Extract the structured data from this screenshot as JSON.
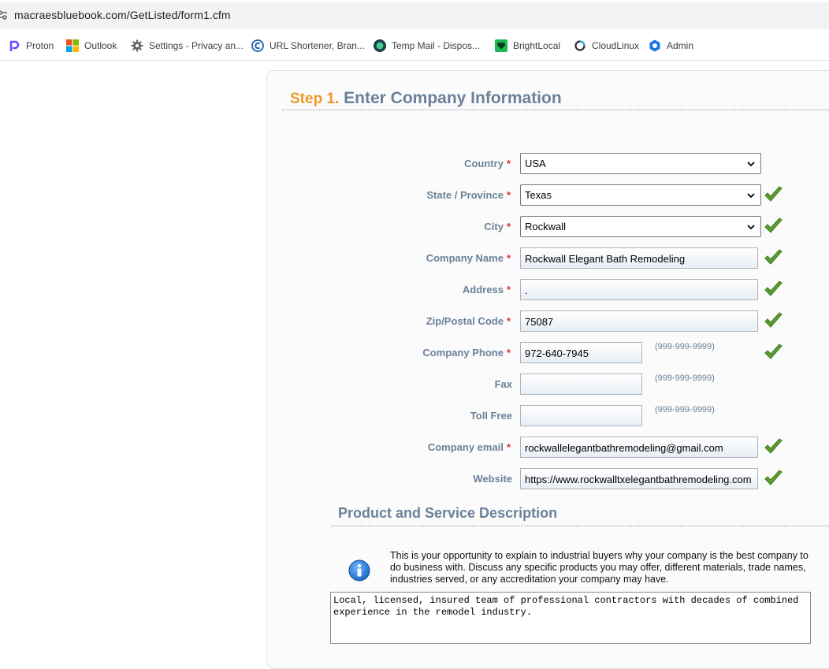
{
  "browser": {
    "url": "macraesbluebook.com/GetListed/form1.cfm",
    "bookmarks": [
      {
        "label": "Proton",
        "icon": "proton-icon"
      },
      {
        "label": "Outlook",
        "icon": "microsoft-icon"
      },
      {
        "label": "Settings - Privacy an...",
        "icon": "gear-icon"
      },
      {
        "label": "URL Shortener, Bran...",
        "icon": "link-shortener-icon"
      },
      {
        "label": "Temp Mail - Dispos...",
        "icon": "temp-mail-icon"
      },
      {
        "label": "BrightLocal",
        "icon": "brightlocal-icon"
      },
      {
        "label": "CloudLinux",
        "icon": "cloudlinux-icon"
      },
      {
        "label": "Admin",
        "icon": "admin-icon"
      }
    ]
  },
  "form": {
    "step_num": "Step 1.",
    "step_title": "Enter Company Information",
    "required_mark": "*",
    "fields": {
      "country": {
        "label": "Country",
        "value": "USA"
      },
      "state": {
        "label": "State / Province",
        "value": "Texas"
      },
      "city": {
        "label": "City",
        "value": "Rockwall"
      },
      "company_name": {
        "label": "Company Name",
        "value": "Rockwall Elegant Bath Remodeling"
      },
      "address": {
        "label": "Address",
        "value": "."
      },
      "zip": {
        "label": "Zip/Postal Code",
        "value": "75087"
      },
      "phone": {
        "label": "Company Phone",
        "value": "972-640-7945",
        "hint": "(999-999-9999)"
      },
      "fax": {
        "label": "Fax",
        "value": "",
        "hint": "(999-999-9999)"
      },
      "toll_free": {
        "label": "Toll Free",
        "value": "",
        "hint": "(999-999-9999)"
      },
      "email": {
        "label": "Company email",
        "value": "rockwallelegantbathremodeling@gmail.com"
      },
      "website": {
        "label": "Website",
        "value": "https://www.rockwalltxelegantbathremodeling.com"
      }
    },
    "section_title": "Product and Service Description",
    "info_lines": [
      "This is your opportunity to explain to industrial buyers why your company is the best company to",
      "do business with. Discuss any specific products you may offer, different materials, trade names,",
      "industries served, or any accreditation your company may have."
    ],
    "description": "Local, licensed, insured team of professional contractors with decades of combined\nexperience in the remodel industry."
  },
  "colors": {
    "label": "#6a8199",
    "step_accent": "#ec9a2d",
    "required": "#dd3333",
    "check": "#5a9e2e"
  }
}
